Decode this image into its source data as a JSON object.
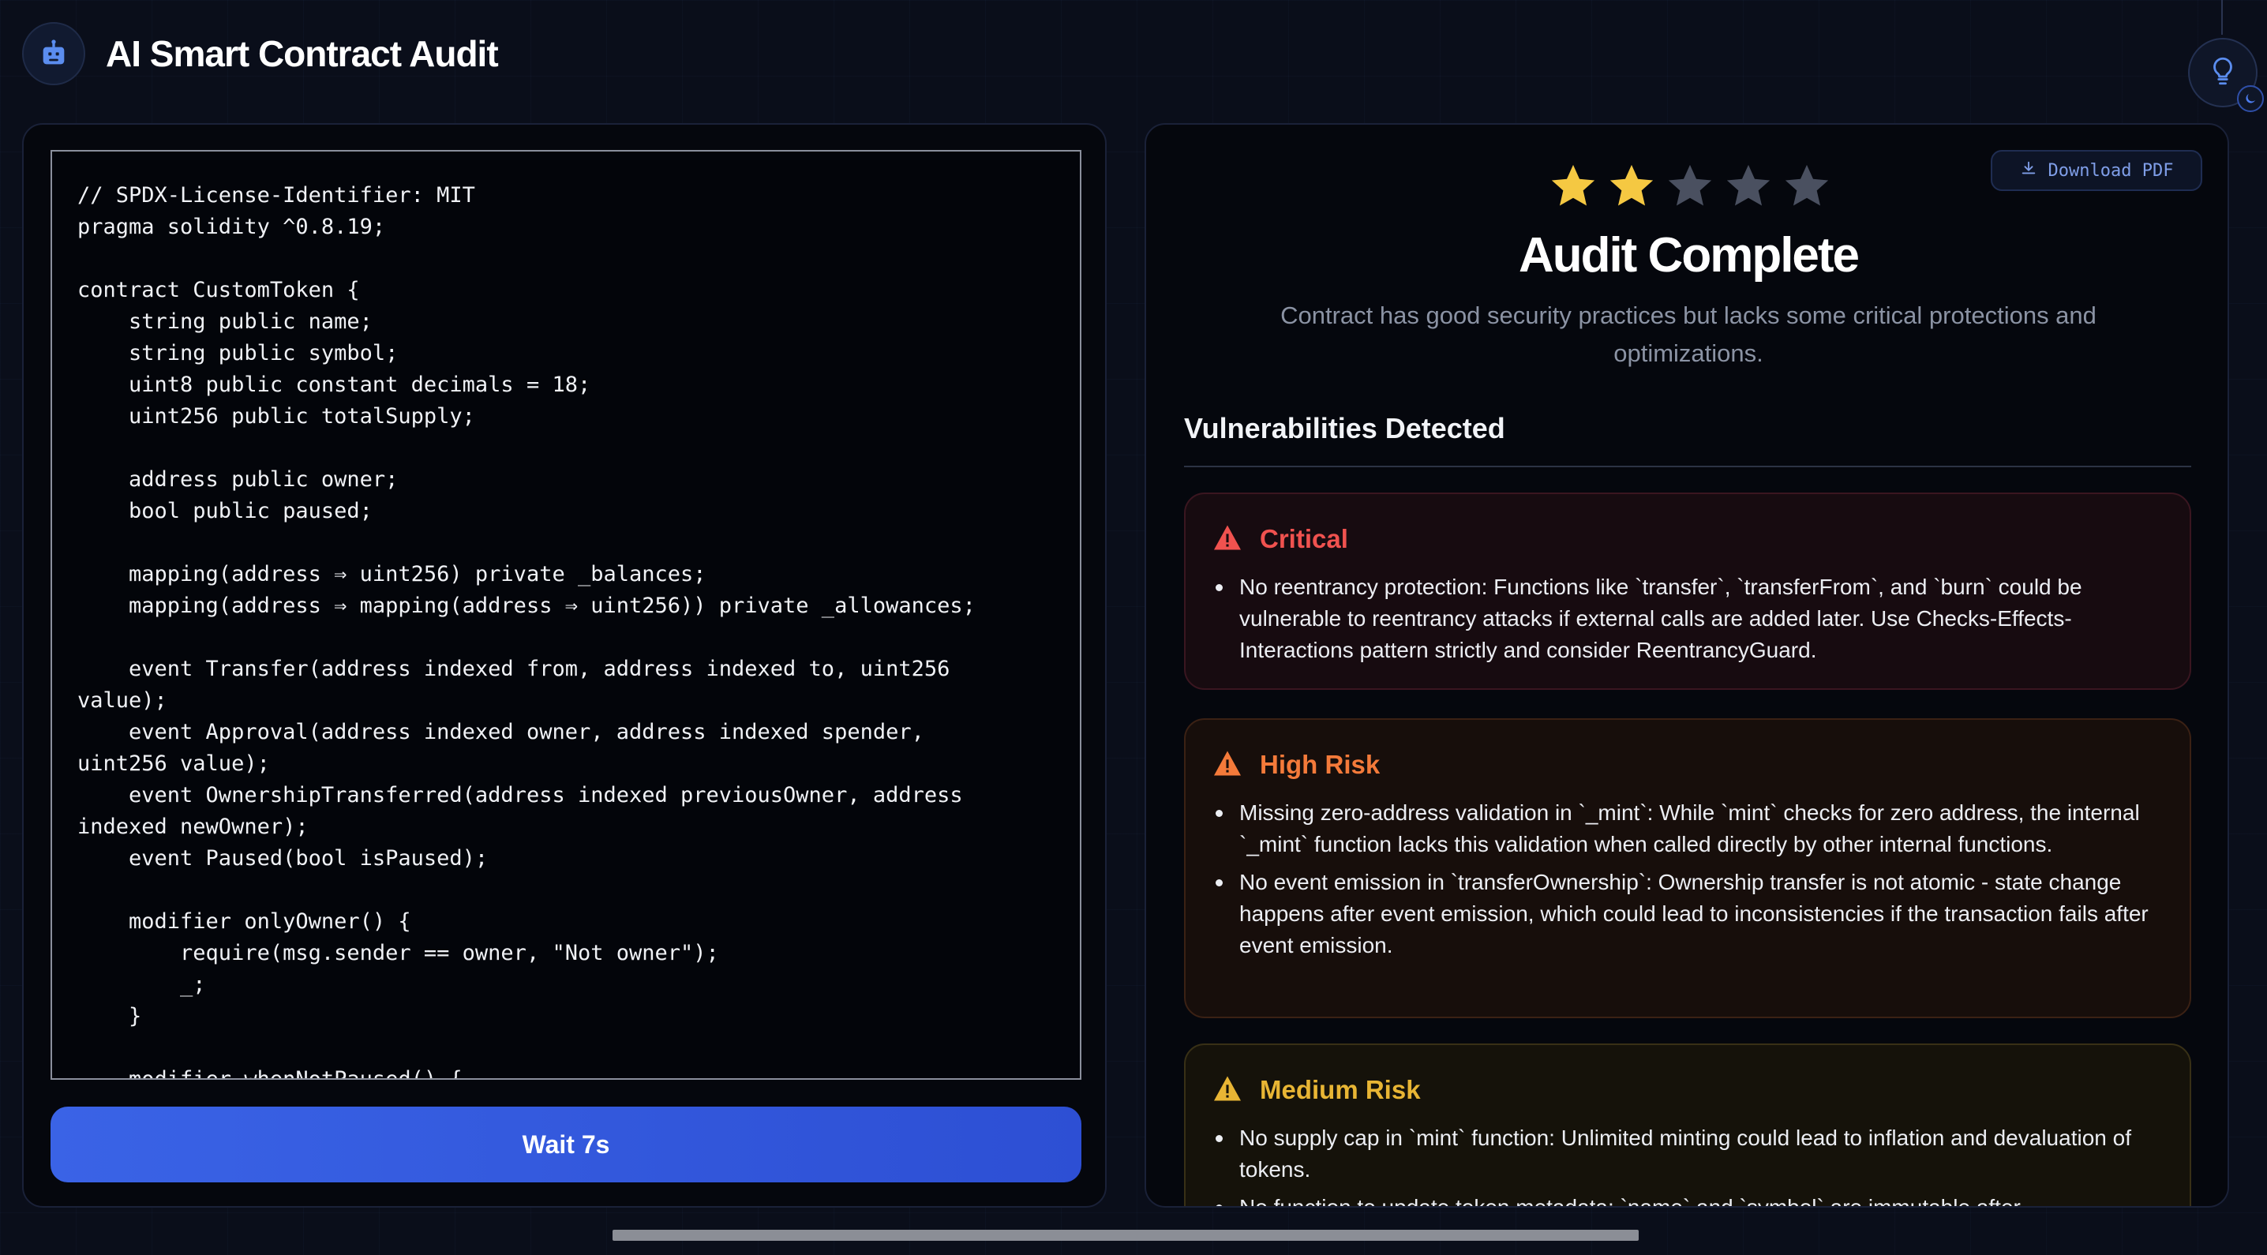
{
  "header": {
    "title": "AI Smart Contract Audit",
    "logo_icon": "robot-icon",
    "theme_icon": "lightbulb-icon",
    "theme_badge_icon": "moon-icon"
  },
  "editor": {
    "code": "// SPDX-License-Identifier: MIT\npragma solidity ^0.8.19;\n\ncontract CustomToken {\n    string public name;\n    string public symbol;\n    uint8 public constant decimals = 18;\n    uint256 public totalSupply;\n\n    address public owner;\n    bool public paused;\n\n    mapping(address ⇒ uint256) private _balances;\n    mapping(address ⇒ mapping(address ⇒ uint256)) private _allowances;\n\n    event Transfer(address indexed from, address indexed to, uint256\nvalue);\n    event Approval(address indexed owner, address indexed spender,\nuint256 value);\n    event OwnershipTransferred(address indexed previousOwner, address\nindexed newOwner);\n    event Paused(bool isPaused);\n\n    modifier onlyOwner() {\n        require(msg.sender == owner, \"Not owner\");\n        _;\n    }\n\n    modifier whenNotPaused() {",
    "wait_label": "Wait 7s"
  },
  "report": {
    "download_label": "Download PDF",
    "rating": 2,
    "rating_max": 5,
    "title": "Audit Complete",
    "summary": "Contract has good security practices but lacks some critical protections and optimizations.",
    "vuln_heading": "Vulnerabilities Detected",
    "cards": [
      {
        "title": "Critical",
        "items": [
          "No reentrancy protection: Functions like `transfer`, `transferFrom`, and `burn` could be vulnerable to reentrancy attacks if external calls are added later. Use Checks-Effects-Interactions pattern strictly and consider ReentrancyGuard."
        ]
      },
      {
        "title": "High Risk",
        "items": [
          "Missing zero-address validation in `_mint`: While `mint` checks for zero address, the internal `_mint` function lacks this validation when called directly by other internal functions.",
          "No event emission in `transferOwnership`: Ownership transfer is not atomic - state change happens after event emission, which could lead to inconsistencies if the transaction fails after event emission."
        ]
      },
      {
        "title": "Medium Risk",
        "items": [
          "No supply cap in `mint` function: Unlimited minting could lead to inflation and devaluation of tokens.",
          "No function to update token metadata: `name` and `symbol` are immutable after"
        ]
      }
    ]
  },
  "colors": {
    "accent": "#3a63e6",
    "critical": "#f0524f",
    "high": "#f47a3a",
    "medium": "#e8b534",
    "star_filled": "#f5c842",
    "star_empty": "#4a5060"
  }
}
